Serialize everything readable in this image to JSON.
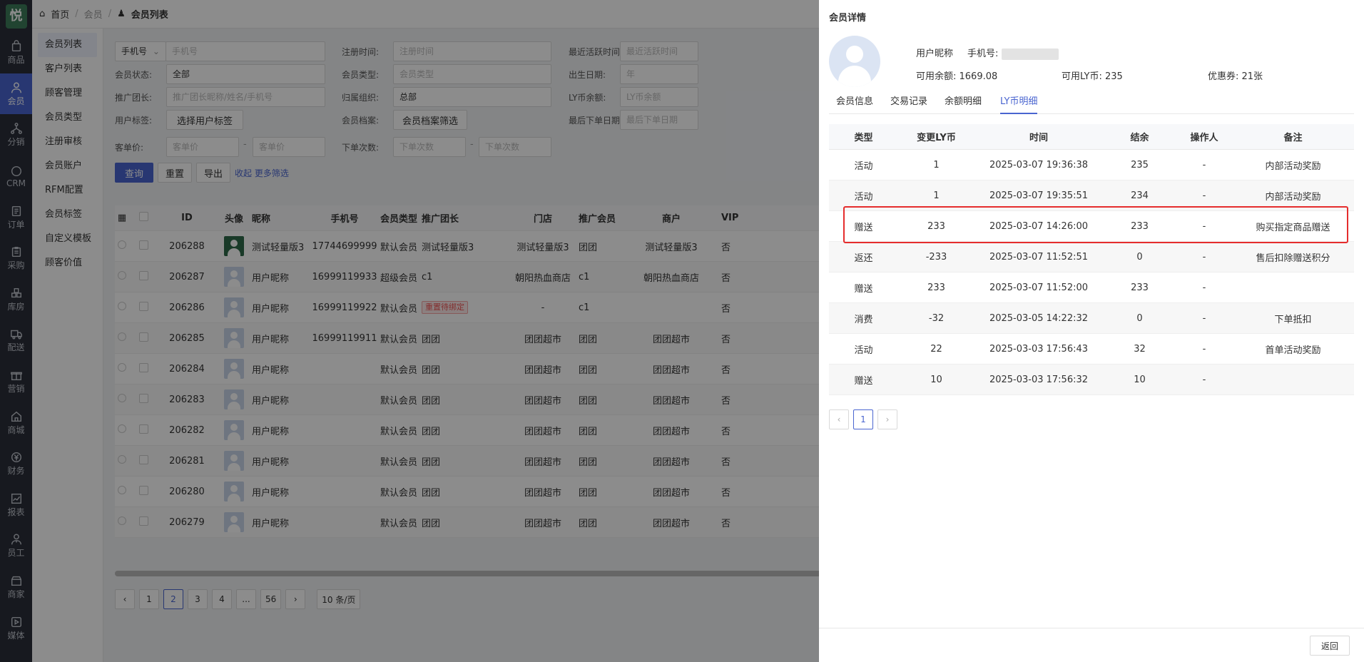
{
  "logo_text": "悦",
  "rail": [
    {
      "label": "商品",
      "icon": "bag-icon"
    },
    {
      "label": "会员",
      "icon": "user-icon",
      "active": true
    },
    {
      "label": "分销",
      "icon": "network-icon"
    },
    {
      "label": "CRM",
      "icon": "crm-icon"
    },
    {
      "label": "订单",
      "icon": "order-icon"
    },
    {
      "label": "采购",
      "icon": "clipboard-icon"
    },
    {
      "label": "库房",
      "icon": "boxes-icon"
    },
    {
      "label": "配送",
      "icon": "truck-icon"
    },
    {
      "label": "营销",
      "icon": "gift-icon"
    },
    {
      "label": "商城",
      "icon": "home-icon"
    },
    {
      "label": "财务",
      "icon": "yen-icon"
    },
    {
      "label": "报表",
      "icon": "chart-icon"
    },
    {
      "label": "员工",
      "icon": "staff-icon"
    },
    {
      "label": "商家",
      "icon": "store-icon"
    },
    {
      "label": "媒体",
      "icon": "play-icon"
    }
  ],
  "breadcrumb": {
    "home": "首页",
    "section": "会员",
    "current": "会员列表"
  },
  "subnav": [
    "会员列表",
    "客户列表",
    "顾客管理",
    "会员类型",
    "注册审核",
    "会员账户",
    "RFM配置",
    "会员标签",
    "自定义模板",
    "顾客价值"
  ],
  "subnav_collapse": "收起",
  "filters": {
    "phone_select": "手机号",
    "phone_placeholder": "手机号",
    "reg_time_label": "注册时间:",
    "reg_time_placeholder": "注册时间",
    "last_active_label": "最近活跃时间:",
    "last_active_placeholder": "最近活跃时间",
    "status_label": "会员状态:",
    "status_value": "全部",
    "type_label": "会员类型:",
    "type_placeholder": "会员类型",
    "birth_label": "出生日期:",
    "birth_placeholder": "年",
    "leader_label": "推广团长:",
    "leader_placeholder": "推广团长昵称/姓名/手机号",
    "org_label": "归属组织:",
    "org_value": "总部",
    "lycoin_label": "LY币余额:",
    "lycoin_placeholder": "LY币余额",
    "tag_label": "用户标签:",
    "tag_button": "选择用户标签",
    "archive_label": "会员档案:",
    "archive_button": "会员档案筛选",
    "last_order_label": "最后下单日期:",
    "last_order_placeholder": "最后下单日期",
    "price_label": "客单价:",
    "price_min": "客单价",
    "price_max": "客单价",
    "dash": "-",
    "order_count_label": "下单次数:",
    "order_min": "下单次数",
    "order_max": "下单次数",
    "query": "查询",
    "reset": "重置",
    "export": "导出",
    "more": "收起 更多筛选"
  },
  "table": {
    "headers": [
      "ID",
      "头像",
      "昵称",
      "手机号",
      "会员类型",
      "推广团长",
      "门店",
      "推广会员",
      "商户",
      "VIP"
    ],
    "rows": [
      {
        "id": "206288",
        "avatar": "logo",
        "nick": "测试轻量版3",
        "phone": "17744699999",
        "type": "默认会员",
        "leader": "测试轻量版3",
        "store": "测试轻量版3",
        "promoter": "团团",
        "merchant": "测试轻量版3",
        "vip": "否"
      },
      {
        "id": "206287",
        "avatar": "user",
        "nick": "用户昵称",
        "phone": "16999119933",
        "type": "超级会员",
        "leader": "c1",
        "store": "朝阳热血商店",
        "promoter": "c1",
        "merchant": "朝阳热血商店",
        "vip": "否"
      },
      {
        "id": "206286",
        "avatar": "user",
        "nick": "用户昵称",
        "phone": "16999119922",
        "type": "默认会员",
        "leader": "重置待绑定",
        "store": "-",
        "promoter": "c1",
        "merchant": "",
        "vip": "否",
        "tag": true
      },
      {
        "id": "206285",
        "avatar": "user",
        "nick": "用户昵称",
        "phone": "16999119911",
        "type": "默认会员",
        "leader": "团团",
        "store": "团团超市",
        "promoter": "团团",
        "merchant": "团团超市",
        "vip": "否"
      },
      {
        "id": "206284",
        "avatar": "user",
        "nick": "用户昵称",
        "phone": "",
        "type": "默认会员",
        "leader": "团团",
        "store": "团团超市",
        "promoter": "团团",
        "merchant": "团团超市",
        "vip": "否"
      },
      {
        "id": "206283",
        "avatar": "user",
        "nick": "用户昵称",
        "phone": "",
        "type": "默认会员",
        "leader": "团团",
        "store": "团团超市",
        "promoter": "团团",
        "merchant": "团团超市",
        "vip": "否"
      },
      {
        "id": "206282",
        "avatar": "user",
        "nick": "用户昵称",
        "phone": "",
        "type": "默认会员",
        "leader": "团团",
        "store": "团团超市",
        "promoter": "团团",
        "merchant": "团团超市",
        "vip": "否"
      },
      {
        "id": "206281",
        "avatar": "user",
        "nick": "用户昵称",
        "phone": "",
        "type": "默认会员",
        "leader": "团团",
        "store": "团团超市",
        "promoter": "团团",
        "merchant": "团团超市",
        "vip": "否"
      },
      {
        "id": "206280",
        "avatar": "user",
        "nick": "用户昵称",
        "phone": "",
        "type": "默认会员",
        "leader": "团团",
        "store": "团团超市",
        "promoter": "团团",
        "merchant": "团团超市",
        "vip": "否"
      },
      {
        "id": "206279",
        "avatar": "user",
        "nick": "用户昵称",
        "phone": "",
        "type": "默认会员",
        "leader": "团团",
        "store": "团团超市",
        "promoter": "团团",
        "merchant": "团团超市",
        "vip": "否"
      }
    ]
  },
  "pager": {
    "pages": [
      "1",
      "2",
      "3",
      "4",
      "...",
      "56"
    ],
    "current": "2",
    "size": "10 条/页"
  },
  "drawer": {
    "title": "会员详情",
    "nick_label": "用户昵称",
    "phone_label": "手机号:",
    "balance": "可用余额: 1669.08",
    "lycoin": "可用LY币: 235",
    "coupons": "优惠券: 21张",
    "tabs": [
      "会员信息",
      "交易记录",
      "余额明细",
      "LY币明细"
    ],
    "active_tab": 3,
    "headers": [
      "类型",
      "变更LY币",
      "时间",
      "结余",
      "操作人",
      "备注"
    ],
    "rows": [
      [
        "活动",
        "1",
        "2025-03-07 19:36:38",
        "235",
        "-",
        "内部活动奖励"
      ],
      [
        "活动",
        "1",
        "2025-03-07 19:35:51",
        "234",
        "-",
        "内部活动奖励"
      ],
      [
        "赠送",
        "233",
        "2025-03-07 14:26:00",
        "233",
        "-",
        "购买指定商品赠送"
      ],
      [
        "返还",
        "-233",
        "2025-03-07 11:52:51",
        "0",
        "-",
        "售后扣除赠送积分"
      ],
      [
        "赠送",
        "233",
        "2025-03-07 11:52:00",
        "233",
        "-",
        ""
      ],
      [
        "消费",
        "-32",
        "2025-03-05 14:22:32",
        "0",
        "-",
        "下单抵扣"
      ],
      [
        "活动",
        "22",
        "2025-03-03 17:56:43",
        "32",
        "-",
        "首单活动奖励"
      ],
      [
        "赠送",
        "10",
        "2025-03-03 17:56:32",
        "10",
        "-",
        ""
      ]
    ],
    "page": "1",
    "back": "返回"
  },
  "colors": {
    "accent": "#4a65d0",
    "highlight": "#e52d2d",
    "rail": "#2b2f3a"
  }
}
